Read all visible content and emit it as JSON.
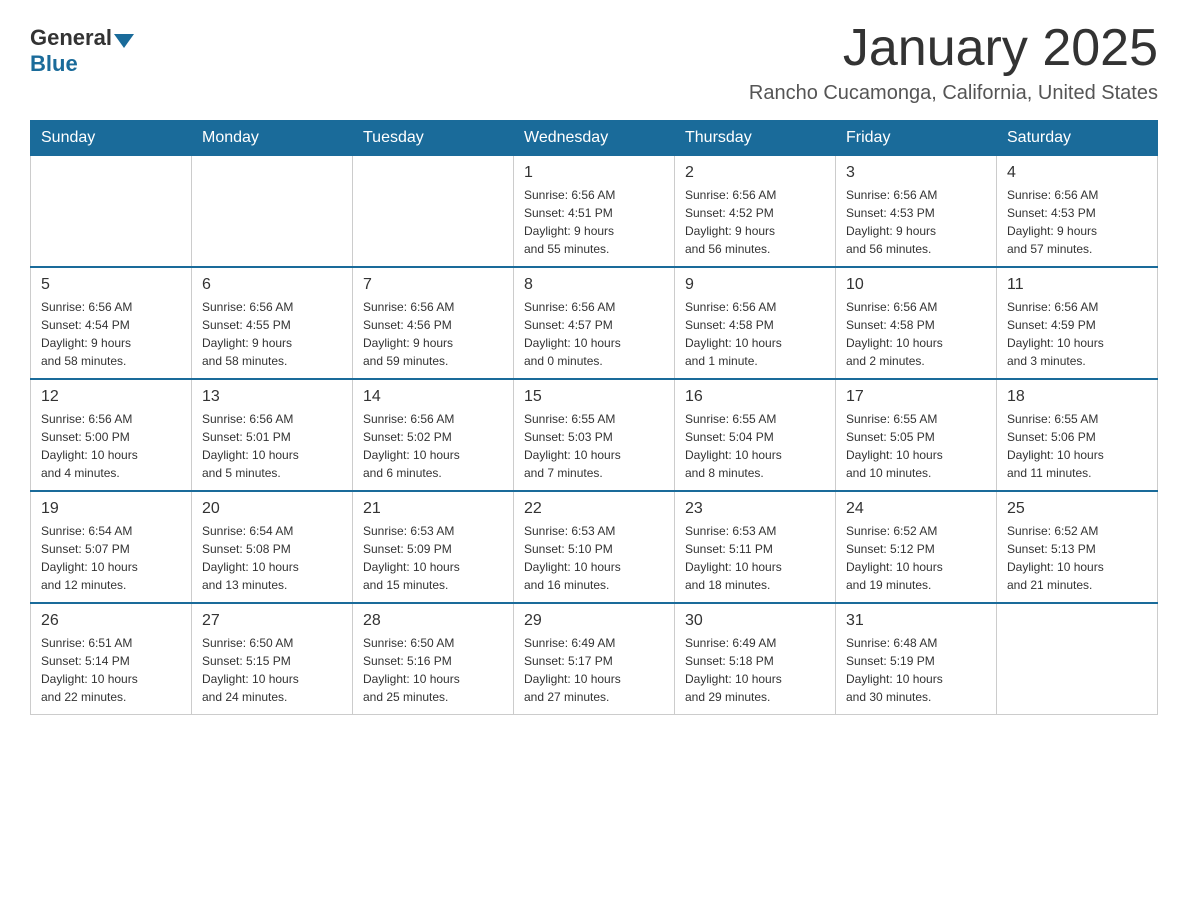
{
  "header": {
    "logo": {
      "general": "General",
      "blue": "Blue"
    },
    "title": "January 2025",
    "location": "Rancho Cucamonga, California, United States"
  },
  "weekdays": [
    "Sunday",
    "Monday",
    "Tuesday",
    "Wednesday",
    "Thursday",
    "Friday",
    "Saturday"
  ],
  "weeks": [
    [
      {
        "day": "",
        "info": ""
      },
      {
        "day": "",
        "info": ""
      },
      {
        "day": "",
        "info": ""
      },
      {
        "day": "1",
        "info": "Sunrise: 6:56 AM\nSunset: 4:51 PM\nDaylight: 9 hours\nand 55 minutes."
      },
      {
        "day": "2",
        "info": "Sunrise: 6:56 AM\nSunset: 4:52 PM\nDaylight: 9 hours\nand 56 minutes."
      },
      {
        "day": "3",
        "info": "Sunrise: 6:56 AM\nSunset: 4:53 PM\nDaylight: 9 hours\nand 56 minutes."
      },
      {
        "day": "4",
        "info": "Sunrise: 6:56 AM\nSunset: 4:53 PM\nDaylight: 9 hours\nand 57 minutes."
      }
    ],
    [
      {
        "day": "5",
        "info": "Sunrise: 6:56 AM\nSunset: 4:54 PM\nDaylight: 9 hours\nand 58 minutes."
      },
      {
        "day": "6",
        "info": "Sunrise: 6:56 AM\nSunset: 4:55 PM\nDaylight: 9 hours\nand 58 minutes."
      },
      {
        "day": "7",
        "info": "Sunrise: 6:56 AM\nSunset: 4:56 PM\nDaylight: 9 hours\nand 59 minutes."
      },
      {
        "day": "8",
        "info": "Sunrise: 6:56 AM\nSunset: 4:57 PM\nDaylight: 10 hours\nand 0 minutes."
      },
      {
        "day": "9",
        "info": "Sunrise: 6:56 AM\nSunset: 4:58 PM\nDaylight: 10 hours\nand 1 minute."
      },
      {
        "day": "10",
        "info": "Sunrise: 6:56 AM\nSunset: 4:58 PM\nDaylight: 10 hours\nand 2 minutes."
      },
      {
        "day": "11",
        "info": "Sunrise: 6:56 AM\nSunset: 4:59 PM\nDaylight: 10 hours\nand 3 minutes."
      }
    ],
    [
      {
        "day": "12",
        "info": "Sunrise: 6:56 AM\nSunset: 5:00 PM\nDaylight: 10 hours\nand 4 minutes."
      },
      {
        "day": "13",
        "info": "Sunrise: 6:56 AM\nSunset: 5:01 PM\nDaylight: 10 hours\nand 5 minutes."
      },
      {
        "day": "14",
        "info": "Sunrise: 6:56 AM\nSunset: 5:02 PM\nDaylight: 10 hours\nand 6 minutes."
      },
      {
        "day": "15",
        "info": "Sunrise: 6:55 AM\nSunset: 5:03 PM\nDaylight: 10 hours\nand 7 minutes."
      },
      {
        "day": "16",
        "info": "Sunrise: 6:55 AM\nSunset: 5:04 PM\nDaylight: 10 hours\nand 8 minutes."
      },
      {
        "day": "17",
        "info": "Sunrise: 6:55 AM\nSunset: 5:05 PM\nDaylight: 10 hours\nand 10 minutes."
      },
      {
        "day": "18",
        "info": "Sunrise: 6:55 AM\nSunset: 5:06 PM\nDaylight: 10 hours\nand 11 minutes."
      }
    ],
    [
      {
        "day": "19",
        "info": "Sunrise: 6:54 AM\nSunset: 5:07 PM\nDaylight: 10 hours\nand 12 minutes."
      },
      {
        "day": "20",
        "info": "Sunrise: 6:54 AM\nSunset: 5:08 PM\nDaylight: 10 hours\nand 13 minutes."
      },
      {
        "day": "21",
        "info": "Sunrise: 6:53 AM\nSunset: 5:09 PM\nDaylight: 10 hours\nand 15 minutes."
      },
      {
        "day": "22",
        "info": "Sunrise: 6:53 AM\nSunset: 5:10 PM\nDaylight: 10 hours\nand 16 minutes."
      },
      {
        "day": "23",
        "info": "Sunrise: 6:53 AM\nSunset: 5:11 PM\nDaylight: 10 hours\nand 18 minutes."
      },
      {
        "day": "24",
        "info": "Sunrise: 6:52 AM\nSunset: 5:12 PM\nDaylight: 10 hours\nand 19 minutes."
      },
      {
        "day": "25",
        "info": "Sunrise: 6:52 AM\nSunset: 5:13 PM\nDaylight: 10 hours\nand 21 minutes."
      }
    ],
    [
      {
        "day": "26",
        "info": "Sunrise: 6:51 AM\nSunset: 5:14 PM\nDaylight: 10 hours\nand 22 minutes."
      },
      {
        "day": "27",
        "info": "Sunrise: 6:50 AM\nSunset: 5:15 PM\nDaylight: 10 hours\nand 24 minutes."
      },
      {
        "day": "28",
        "info": "Sunrise: 6:50 AM\nSunset: 5:16 PM\nDaylight: 10 hours\nand 25 minutes."
      },
      {
        "day": "29",
        "info": "Sunrise: 6:49 AM\nSunset: 5:17 PM\nDaylight: 10 hours\nand 27 minutes."
      },
      {
        "day": "30",
        "info": "Sunrise: 6:49 AM\nSunset: 5:18 PM\nDaylight: 10 hours\nand 29 minutes."
      },
      {
        "day": "31",
        "info": "Sunrise: 6:48 AM\nSunset: 5:19 PM\nDaylight: 10 hours\nand 30 minutes."
      },
      {
        "day": "",
        "info": ""
      }
    ]
  ]
}
